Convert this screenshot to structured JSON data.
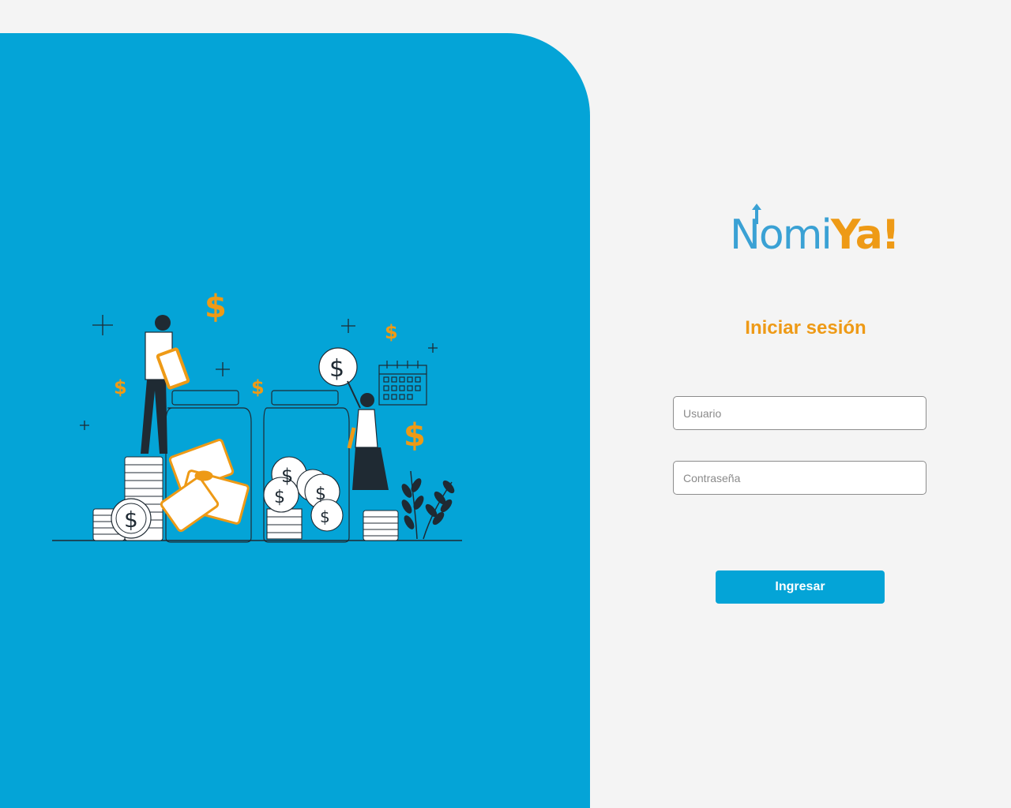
{
  "brand": {
    "logo_prefix": "Nomi",
    "logo_suffix": "Ya!",
    "primary_color": "#04a4d7",
    "accent_color": "#ee9a16"
  },
  "login": {
    "title": "Iniciar sesión",
    "username_placeholder": "Usuario",
    "password_placeholder": "Contraseña",
    "submit_label": "Ingresar"
  },
  "illustration": {
    "subject": "people saving money in jars with coins, bills and calendar",
    "icons": [
      "dollar-sign",
      "plus-sparkle",
      "coin",
      "calendar",
      "plant"
    ]
  }
}
